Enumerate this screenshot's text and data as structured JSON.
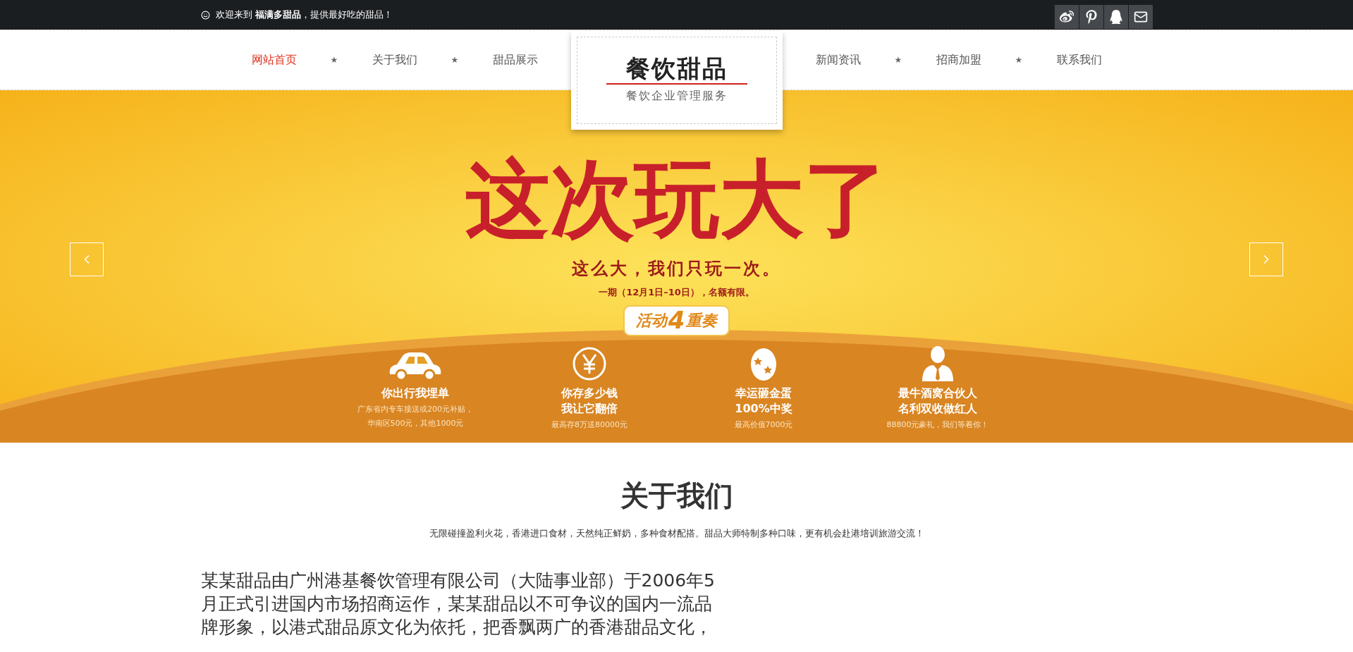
{
  "top_bar": {
    "welcome": "欢迎来到 **福满多甜品**，提供最好吃的甜品！"
  },
  "nav": {
    "left": [
      {
        "label": "网站首页",
        "selected": true
      },
      {
        "label": "关于我们",
        "selected": false
      },
      {
        "label": "甜品展示",
        "selected": false
      }
    ],
    "right": [
      {
        "label": "新闻资讯",
        "selected": false
      },
      {
        "label": "招商加盟",
        "selected": false
      },
      {
        "label": "联系我们",
        "selected": false
      }
    ],
    "separator": "★"
  },
  "logo": {
    "title": "餐饮甜品",
    "subtitle": "餐饮企业管理服务"
  },
  "banner": {
    "headline": "这次玩大了",
    "slogan": "这么大，我们只玩一次。",
    "period": "一期（12月1日–10日），名额有限。",
    "badge": {
      "before": "活动",
      "number": "4",
      "after": "重奏"
    },
    "features": [
      {
        "title_lines": [
          "你出行我埋单"
        ],
        "note_lines": [
          "广东省内专车接送或200元补贴，",
          "华南区500元，其他1000元"
        ]
      },
      {
        "title_lines": [
          "你存多少钱",
          "我让它翻倍"
        ],
        "note_lines": [
          "最高存8万送80000元"
        ]
      },
      {
        "title_lines": [
          "幸运砸金蛋",
          "100%中奖"
        ],
        "note_lines": [
          "最高价值7000元"
        ]
      },
      {
        "title_lines": [
          "最牛酒窝合伙人",
          "名利双收做红人"
        ],
        "note_lines": [
          "88800元豪礼，我们等着你！"
        ]
      }
    ]
  },
  "about": {
    "title": "关于我们",
    "subtitle": "无限碰撞盈利火花，香港进口食材，天然纯正鲜奶，多种食材配搭。甜品大师特制多种口味，更有机会赴港培训旅游交流！",
    "paragraph": "某某甜品由广州港基餐饮管理有限公司（大陆事业部）于2006年5月正式引进国内市场招商运作，某某甜品以不可争议的国内一流品牌形象，以港式甜品原文化为依托，把香飘两广的香港甜品文化，"
  }
}
